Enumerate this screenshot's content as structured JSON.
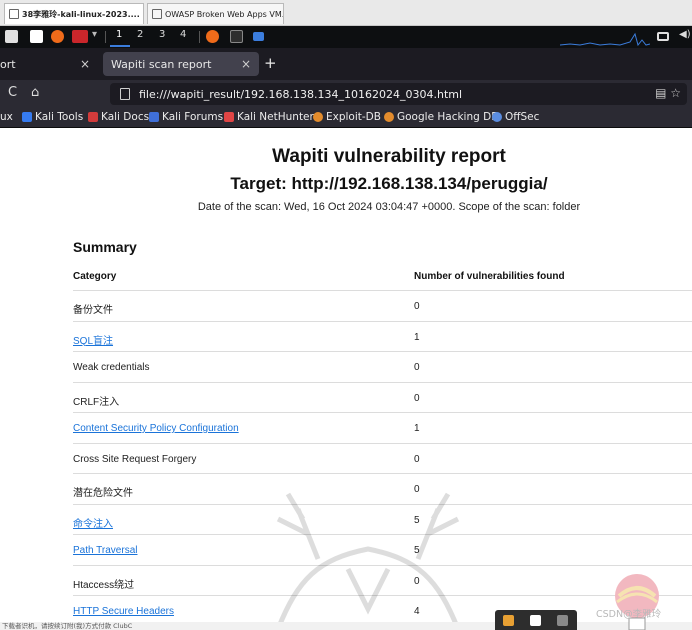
{
  "host_tabs": [
    {
      "title": "38李雅玲-kali-linux-2023....",
      "active": true
    },
    {
      "title": "OWASP Broken Web Apps VM...",
      "active": false
    }
  ],
  "panel": {
    "workspaces": [
      "1",
      "2",
      "3",
      "4"
    ],
    "active_workspace": "1"
  },
  "browser": {
    "tabs": [
      {
        "title": "ort",
        "active": false
      },
      {
        "title": "Wapiti scan report",
        "active": true
      }
    ],
    "new_tab": "+",
    "close_glyph": "×",
    "url": "file:///wapiti_result/192.168.138.134_10162024_0304.html",
    "bookmarks": [
      {
        "label": "ux",
        "icon": "folder-icon",
        "color": "#2b2a33"
      },
      {
        "label": "Kali Tools",
        "icon": "kali-icon",
        "color": "#367bf0"
      },
      {
        "label": "Kali Docs",
        "icon": "docs-icon",
        "color": "#d23b3b"
      },
      {
        "label": "Kali Forums",
        "icon": "forums-icon",
        "color": "#3f6fd8"
      },
      {
        "label": "Kali NetHunter",
        "icon": "nethunter-icon",
        "color": "#e04545"
      },
      {
        "label": "Exploit-DB",
        "icon": "exploitdb-icon",
        "color": "#e38c2d"
      },
      {
        "label": "Google Hacking DB",
        "icon": "ghdb-icon",
        "color": "#e38c2d"
      },
      {
        "label": "OffSec",
        "icon": "offsec-icon",
        "color": "#5b8de0"
      }
    ]
  },
  "report": {
    "title": "Wapiti vulnerability report",
    "target": "Target: http://192.168.138.134/peruggia/",
    "meta": "Date of the scan: Wed, 16 Oct 2024 03:04:47 +0000. Scope of the scan: folder",
    "summary_heading": "Summary",
    "col_category": "Category",
    "col_count": "Number of vulnerabilities found",
    "rows": [
      {
        "category": "备份文件",
        "count": "0",
        "link": false
      },
      {
        "category": "SQL盲注",
        "count": "1",
        "link": true
      },
      {
        "category": "Weak credentials",
        "count": "0",
        "link": false
      },
      {
        "category": "CRLF注入",
        "count": "0",
        "link": false
      },
      {
        "category": "Content Security Policy Configuration",
        "count": "1",
        "link": true
      },
      {
        "category": "Cross Site Request Forgery",
        "count": "0",
        "link": false
      },
      {
        "category": "潜在危险文件",
        "count": "0",
        "link": false
      },
      {
        "category": "命令注入",
        "count": "5",
        "link": true
      },
      {
        "category": "Path Traversal",
        "count": "5",
        "link": true
      },
      {
        "category": "Htaccess绕过",
        "count": "0",
        "link": false
      },
      {
        "category": "HTTP Secure Headers",
        "count": "4",
        "link": true
      }
    ]
  },
  "overlays": {
    "status_text": "下载者识机，请按续订附(我)方式付款 ClubC",
    "corner_text": "CSDN@李雅玲"
  },
  "colors": {
    "link": "#1a73d9",
    "firefox_dark": "#1c1b22",
    "toolbar": "#2b2a33",
    "panel": "#0d0f11",
    "accent": "#3b7ddd"
  }
}
